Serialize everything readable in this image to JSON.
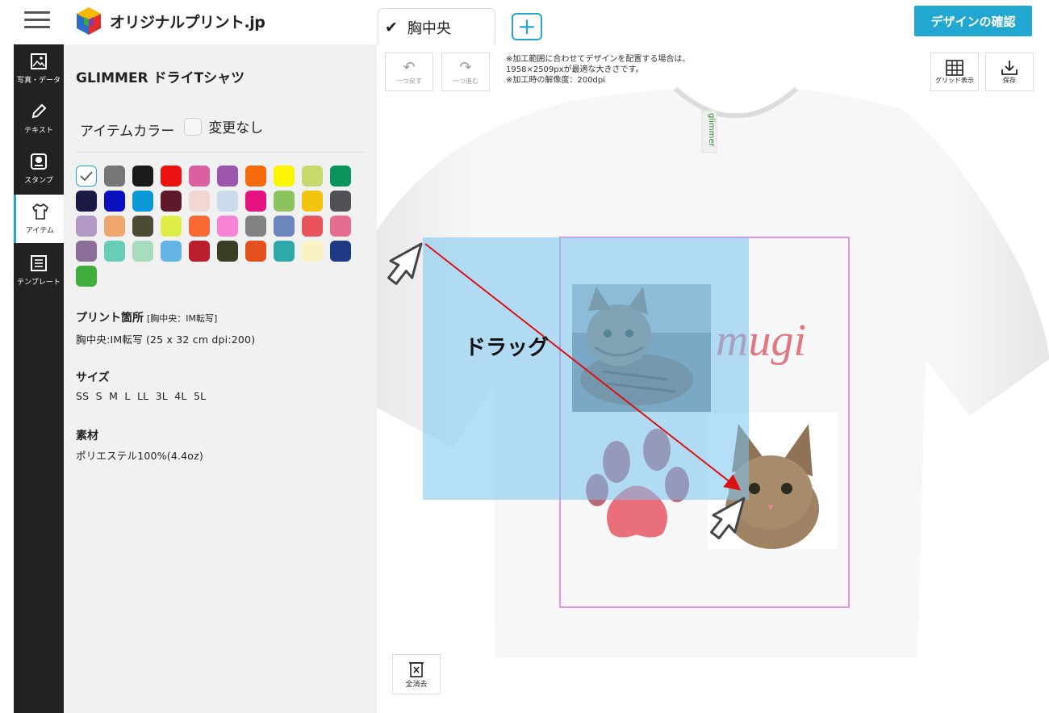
{
  "header": {
    "logo_text": "オリジナルプリント.jp",
    "active_tab": "胸中央",
    "add_tab": "+",
    "confirm_button": "デザインの確認"
  },
  "rail": {
    "items": [
      {
        "label": "写真・データ",
        "icon": "image-icon"
      },
      {
        "label": "テキスト",
        "icon": "pen-icon"
      },
      {
        "label": "スタンプ",
        "icon": "stamp-icon"
      },
      {
        "label": "アイテム",
        "icon": "tshirt-icon",
        "active": true
      },
      {
        "label": "テンプレート",
        "icon": "list-icon"
      }
    ]
  },
  "panel": {
    "product_name": "GLIMMER ドライTシャツ",
    "item_color_label": "アイテムカラー",
    "no_change_label": "変更なし",
    "swatch_colors": [
      "#ffffff",
      "#767676",
      "#1a1a1a",
      "#ee1111",
      "#dd5fa0",
      "#9b55ad",
      "#f56a0c",
      "#fbf500",
      "#c6da6b",
      "#08945a",
      "#1b1a46",
      "#0a10c0",
      "#0a99d7",
      "#5e1a2a",
      "#f0d7d2",
      "#cadbec",
      "#e51280",
      "#8cc360",
      "#f2c410",
      "#505055",
      "#b39ac6",
      "#eea66c",
      "#4c4a32",
      "#dfee45",
      "#f86934",
      "#f783d6",
      "#818282",
      "#6c85bf",
      "#e9545c",
      "#e56d8f",
      "#8b6f98",
      "#68cdb4",
      "#a9dcbf",
      "#63b4e5",
      "#bb1f2e",
      "#393e24",
      "#e5511c",
      "#2fa8a8",
      "#f7f3c2",
      "#1e3985",
      "#3fae3e"
    ],
    "print_location_label": "プリント箇所",
    "print_location_tag": "[胸中央：IM転写]",
    "print_location_value": "胸中央:IM転写 (25 x 32 cm dpi:200)",
    "size_label": "サイズ",
    "sizes": "SS  S  M  L  LL  3L  4L  5L",
    "material_label": "素材",
    "material_value": "ポリエステル100%(4.4oz)"
  },
  "canvas": {
    "undo_label": "一つ戻す",
    "redo_label": "一つ進む",
    "notice_lines": [
      "※加工範囲に合わせてデザインを配置する場合は、",
      "1958×2509pxが最適な大きさです。",
      "※加工時の解像度：200dpi"
    ],
    "grid_label": "グリッド表示",
    "save_label": "保存",
    "clear_label": "全消去",
    "neck_tag_text": "glimmer",
    "design_text": "mugi",
    "drag_label": "ドラッグ"
  },
  "colors": {
    "accent": "#22a8d0",
    "rail_bg": "#222222",
    "panel_bg": "#f1f1f1",
    "print_area_border": "#e070e0",
    "drag_arrow": "#dd1111"
  }
}
